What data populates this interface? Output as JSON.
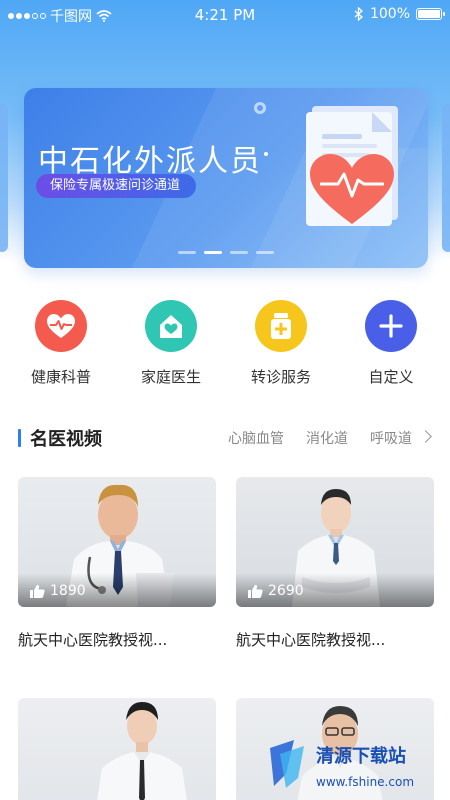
{
  "status_bar": {
    "carrier": "千图网",
    "time": "4:21 PM",
    "battery": "100%",
    "battery_level": 1.0
  },
  "banner": {
    "title": "中石化外派人员",
    "subtitle": "保险专属极速问诊通道",
    "slide_count": 4,
    "active_slide": 2
  },
  "quick_entries": [
    {
      "label": "健康科普",
      "icon": "heart-pulse-icon",
      "color": "#f55a4e"
    },
    {
      "label": "家庭医生",
      "icon": "house-heart-icon",
      "color": "#2fc7b4"
    },
    {
      "label": "转诊服务",
      "icon": "medicine-bottle-icon",
      "color": "#f7c61c"
    },
    {
      "label": "自定义",
      "icon": "plus-icon",
      "color": "#4a5fe8"
    }
  ],
  "section": {
    "title": "名医视频",
    "tabs": [
      "心脑血管",
      "消化道",
      "呼吸道"
    ]
  },
  "videos": [
    {
      "likes": "1890",
      "title": "航天中心医院教授视..."
    },
    {
      "likes": "2690",
      "title": "航天中心医院教授视..."
    }
  ],
  "watermark": {
    "brand": "清源下载站",
    "url": "www.fshine.com"
  },
  "colors": {
    "accent": "#2e7cf6",
    "banner_blue": "#3d7fe8"
  }
}
